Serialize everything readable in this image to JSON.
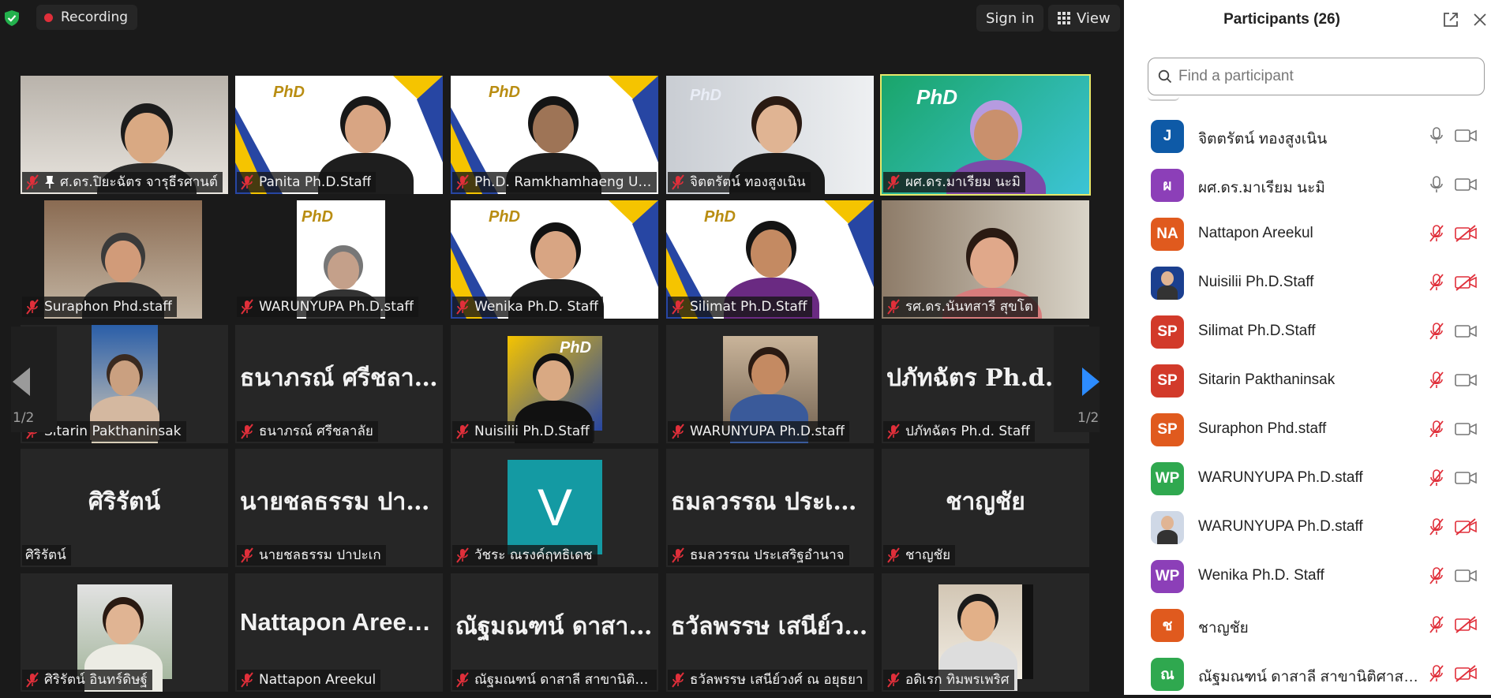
{
  "topbar": {
    "recording_label": "Recording",
    "signin_label": "Sign in",
    "view_label": "View"
  },
  "pager": {
    "left": "1/2",
    "right": "1/2"
  },
  "tiles": [
    {
      "label": "ศ.ดร.ปิยะฉัตร จารุธีรศานต์",
      "big": ""
    },
    {
      "label": "Panita Ph.D.Staff",
      "big": ""
    },
    {
      "label": "Ph.D. Ramkhamhaeng Un...",
      "big": ""
    },
    {
      "label": "จิตตรัตน์ ทองสูงเนิน",
      "big": ""
    },
    {
      "label": "ผศ.ดร.มาเรียม นะมิ",
      "big": ""
    },
    {
      "label": "Suraphon Phd.staff",
      "big": ""
    },
    {
      "label": "WARUNYUPA Ph.D.staff",
      "big": ""
    },
    {
      "label": "Wenika Ph.D. Staff",
      "big": ""
    },
    {
      "label": "Silimat Ph.D.Staff",
      "big": ""
    },
    {
      "label": "รศ.ดร.นันทสารี สุขโต",
      "big": ""
    },
    {
      "label": "Sitarin Pakthaninsak",
      "big": ""
    },
    {
      "label": "ธนาภรณ์ ศรีชลาลัย",
      "big": "ธนาภรณ์ ศรีชลาลัย"
    },
    {
      "label": "Nuisilii Ph.D.Staff",
      "big": ""
    },
    {
      "label": "WARUNYUPA Ph.D.staff",
      "big": ""
    },
    {
      "label": "ปภัทฉัตร Ph.d. Staff",
      "big": "ปภัทฉัตร Ph.d. Staff"
    },
    {
      "label": "ศิริรัตน์",
      "big": "ศิริรัตน์"
    },
    {
      "label": "นายชลธรรม ปาปะเก",
      "big": "นายชลธรรม ปาปะเก"
    },
    {
      "label": "วัชระ ณรงค์ฤทธิเดช",
      "big": "V"
    },
    {
      "label": "ธมลวรรณ ประเสริฐอำนาจ",
      "big": "ธมลวรรณ ประเสริฐอำนาจ"
    },
    {
      "label": "ชาญชัย",
      "big": "ชาญชัย"
    },
    {
      "label": "ศิริรัตน์ อินทร์ดิษฐ์",
      "big": ""
    },
    {
      "label": "Nattapon Areekul",
      "big": "Nattapon Areekul"
    },
    {
      "label": "ณัฐมณฑน์ ดาสาลี สาขานิติศาสตร์",
      "big": "ณัฐมณฑน์ ดาสาลี สาขานิติศาสตร์"
    },
    {
      "label": "ธวัลพรรษ เสนีย์วงศ์ ณ อยุธยา",
      "big": "ธวัลพรรษ เสนีย์วงศ์ ณ อยุธยา"
    },
    {
      "label": "อดิเรก ทิมพรเพริศ",
      "big": ""
    }
  ],
  "panel": {
    "title": "Participants (26)",
    "search_placeholder": "Find a participant",
    "participants": [
      {
        "initials": "J",
        "color": "#0e5aa7",
        "name": "จิตตรัตน์ ทองสูงเนิน",
        "mic": "on",
        "cam": "on"
      },
      {
        "initials": "ผ",
        "color": "#8c3fb8",
        "name": "ผศ.ดร.มาเรียม นะมิ",
        "mic": "on",
        "cam": "on"
      },
      {
        "initials": "NA",
        "color": "#e05a1e",
        "name": "Nattapon Areekul",
        "mic": "off",
        "cam": "off"
      },
      {
        "initials": "",
        "color": "#1b3f8f",
        "name": "Nuisilii Ph.D.Staff",
        "mic": "off",
        "cam": "off"
      },
      {
        "initials": "SP",
        "color": "#d23a2a",
        "name": "Silimat Ph.D.Staff",
        "mic": "off",
        "cam": "on"
      },
      {
        "initials": "SP",
        "color": "#d23a2a",
        "name": "Sitarin Pakthaninsak",
        "mic": "off",
        "cam": "on"
      },
      {
        "initials": "SP",
        "color": "#e05a1e",
        "name": "Suraphon Phd.staff",
        "mic": "off",
        "cam": "on"
      },
      {
        "initials": "WP",
        "color": "#2fa84f",
        "name": "WARUNYUPA Ph.D.staff",
        "mic": "off",
        "cam": "on"
      },
      {
        "initials": "",
        "color": "#cfd8e6",
        "name": "WARUNYUPA Ph.D.staff",
        "mic": "off",
        "cam": "off"
      },
      {
        "initials": "WP",
        "color": "#8c3fb8",
        "name": "Wenika Ph.D. Staff",
        "mic": "off",
        "cam": "on"
      },
      {
        "initials": "ช",
        "color": "#e05a1e",
        "name": "ชาญชัย",
        "mic": "off",
        "cam": "off"
      },
      {
        "initials": "ณ",
        "color": "#2fa84f",
        "name": "ณัฐมณฑน์ ดาสาลี สาขานิติศาสตร์",
        "mic": "off",
        "cam": "off"
      }
    ]
  }
}
